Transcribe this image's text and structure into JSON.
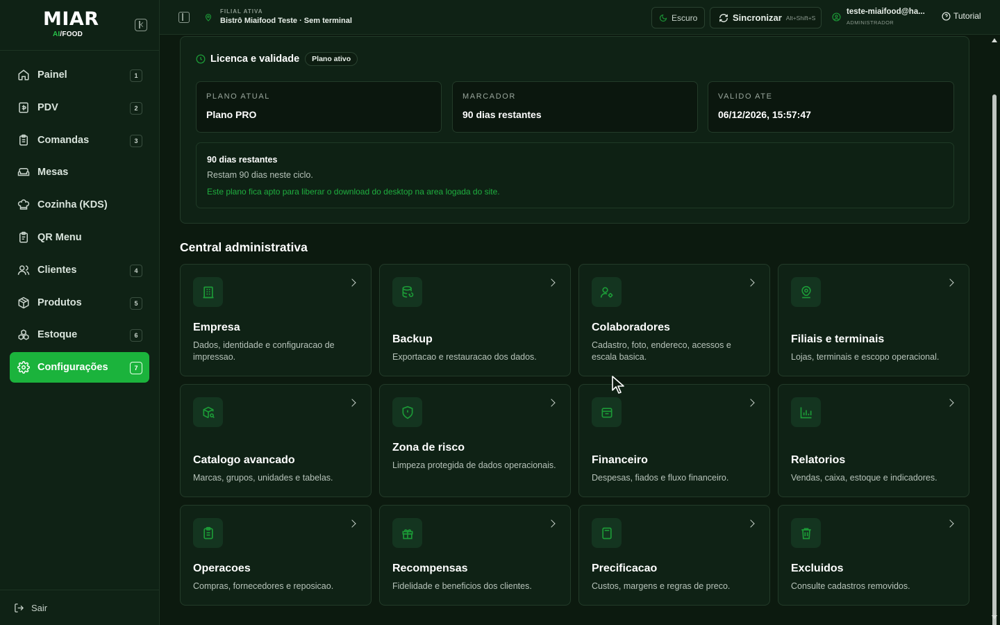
{
  "brand": {
    "name": "MIAR",
    "sub_ai": "AI",
    "sub_rest": "/FOOD"
  },
  "nav": [
    {
      "label": "Painel",
      "badge": "1",
      "icon": "home-icon"
    },
    {
      "label": "PDV",
      "badge": "2",
      "icon": "cash-register-icon"
    },
    {
      "label": "Comandas",
      "badge": "3",
      "icon": "clipboard-icon"
    },
    {
      "label": "Mesas",
      "badge": "",
      "icon": "couch-icon"
    },
    {
      "label": "Cozinha (KDS)",
      "badge": "",
      "icon": "chef-hat-icon"
    },
    {
      "label": "QR Menu",
      "badge": "",
      "icon": "menu-clipboard-icon"
    },
    {
      "label": "Clientes",
      "badge": "4",
      "icon": "users-icon"
    },
    {
      "label": "Produtos",
      "badge": "5",
      "icon": "package-icon"
    },
    {
      "label": "Estoque",
      "badge": "6",
      "icon": "boxes-icon"
    },
    {
      "label": "Configurações",
      "badge": "7",
      "icon": "gear-icon",
      "active": true
    }
  ],
  "logout_label": "Sair",
  "topbar": {
    "branch_kicker": "FILIAL ATIVA",
    "branch_name": "Bistrô Miaifood Teste · Sem terminal",
    "theme_label": "Escuro",
    "sync_label": "Sincronizar",
    "sync_shortcut": "Alt+Shift+S",
    "user_email": "teste-miaifood@ha...",
    "user_role": "ADMINISTRADOR",
    "tutorial_label": "Tutorial"
  },
  "license": {
    "title": "Licenca e validade",
    "badge": "Plano ativo",
    "boxes": [
      {
        "key": "PLANO ATUAL",
        "value": "Plano PRO"
      },
      {
        "key": "MARCADOR",
        "value": "90 dias restantes"
      },
      {
        "key": "VALIDO ATE",
        "value": "06/12/2026, 15:57:47"
      }
    ],
    "info_title": "90 dias restantes",
    "info_sub": "Restam 90 dias neste ciclo.",
    "info_note": "Este plano fica apto para liberar o download do desktop na area logada do site."
  },
  "section_title": "Central administrativa",
  "cards": [
    {
      "title": "Empresa",
      "desc": "Dados, identidade e configuracao de impressao.",
      "icon": "building-icon"
    },
    {
      "title": "Backup",
      "desc": "Exportacao e restauracao dos dados.",
      "icon": "database-icon"
    },
    {
      "title": "Colaboradores",
      "desc": "Cadastro, foto, endereco, acessos e escala basica.",
      "icon": "user-gear-icon"
    },
    {
      "title": "Filiais e terminais",
      "desc": "Lojas, terminais e escopo operacional.",
      "icon": "map-pin-user-icon"
    },
    {
      "title": "Catalogo avancado",
      "desc": "Marcas, grupos, unidades e tabelas.",
      "icon": "package-search-icon"
    },
    {
      "title": "Zona de risco",
      "desc": "Limpeza protegida de dados operacionais.",
      "icon": "shield-icon"
    },
    {
      "title": "Financeiro",
      "desc": "Despesas, fiados e fluxo financeiro.",
      "icon": "wallet-icon"
    },
    {
      "title": "Relatorios",
      "desc": "Vendas, caixa, estoque e indicadores.",
      "icon": "bar-chart-icon"
    },
    {
      "title": "Operacoes",
      "desc": "Compras, fornecedores e reposicao.",
      "icon": "clipboard-list-icon"
    },
    {
      "title": "Recompensas",
      "desc": "Fidelidade e beneficios dos clientes.",
      "icon": "gift-icon"
    },
    {
      "title": "Precificacao",
      "desc": "Custos, margens e regras de preco.",
      "icon": "calculator-icon"
    },
    {
      "title": "Excluidos",
      "desc": "Consulte cadastros removidos.",
      "icon": "trash-icon"
    }
  ],
  "colors": {
    "accent": "#1bb33c",
    "bg": "#0c1a0f",
    "panel": "#0f2215",
    "icon_green": "#1c9a37"
  }
}
